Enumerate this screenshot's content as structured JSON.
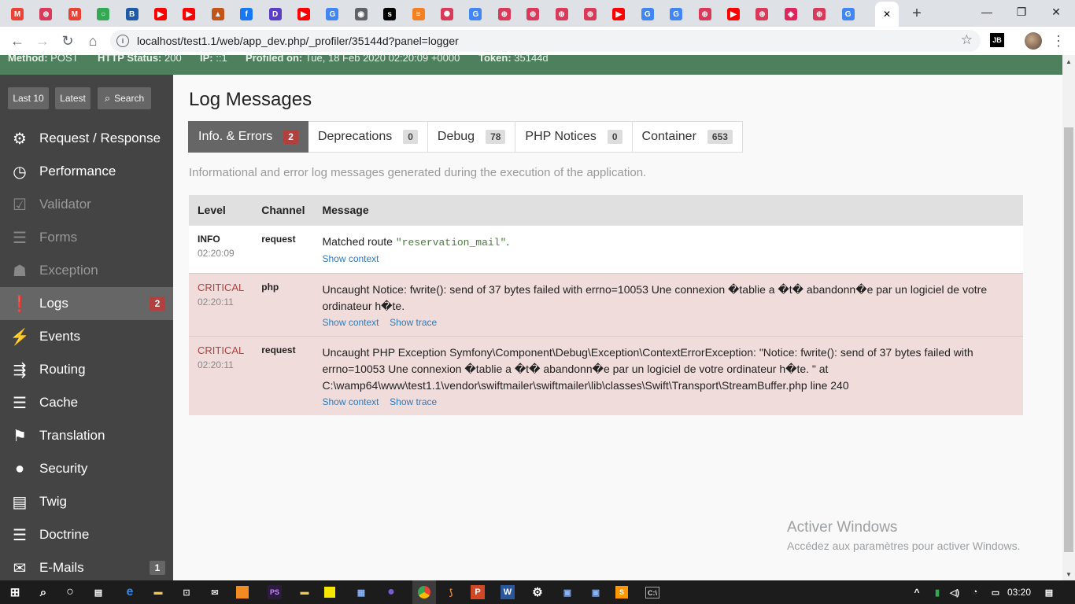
{
  "browser": {
    "url": "localhost/test1.1/web/app_dev.php/_profiler/35144d?panel=logger",
    "tabs": [
      {
        "icon": "gmail-icon",
        "color": "#ea4335",
        "glyph": "M"
      },
      {
        "icon": "web-icon",
        "color": "#d93a5a",
        "glyph": "⊕"
      },
      {
        "icon": "gmail-icon",
        "color": "#ea4335",
        "glyph": "M"
      },
      {
        "icon": "circle-icon",
        "color": "#34a853",
        "glyph": "○"
      },
      {
        "icon": "b-icon",
        "color": "#1f5aa6",
        "glyph": "B"
      },
      {
        "icon": "youtube-icon",
        "color": "#ff0000",
        "glyph": "▶"
      },
      {
        "icon": "youtube-icon",
        "color": "#ff0000",
        "glyph": "▶"
      },
      {
        "icon": "pka-icon",
        "color": "#c2561a",
        "glyph": "▲"
      },
      {
        "icon": "facebook-icon",
        "color": "#1877f2",
        "glyph": "f"
      },
      {
        "icon": "d-icon",
        "color": "#5b3ec8",
        "glyph": "D"
      },
      {
        "icon": "youtube-icon",
        "color": "#ff0000",
        "glyph": "▶"
      },
      {
        "icon": "google-icon",
        "color": "#4285f4",
        "glyph": "G"
      },
      {
        "icon": "globe-icon",
        "color": "#5f6368",
        "glyph": "◉"
      },
      {
        "icon": "symfony-icon",
        "color": "#000000",
        "glyph": "s"
      },
      {
        "icon": "stackoverflow-icon",
        "color": "#f48024",
        "glyph": "≡"
      },
      {
        "icon": "gear-red-icon",
        "color": "#d93a5a",
        "glyph": "✺"
      },
      {
        "icon": "google-icon",
        "color": "#4285f4",
        "glyph": "G"
      },
      {
        "icon": "web-icon",
        "color": "#d93a5a",
        "glyph": "⊕"
      },
      {
        "icon": "web-icon",
        "color": "#d93a5a",
        "glyph": "⊕"
      },
      {
        "icon": "web-icon",
        "color": "#d93a5a",
        "glyph": "⊕"
      },
      {
        "icon": "web-icon",
        "color": "#d93a5a",
        "glyph": "⊕"
      },
      {
        "icon": "youtube-icon",
        "color": "#ff0000",
        "glyph": "▶"
      },
      {
        "icon": "google-icon",
        "color": "#4285f4",
        "glyph": "G"
      },
      {
        "icon": "google-icon",
        "color": "#4285f4",
        "glyph": "G"
      },
      {
        "icon": "web-icon",
        "color": "#d93a5a",
        "glyph": "⊕"
      },
      {
        "icon": "youtube-icon",
        "color": "#ff0000",
        "glyph": "▶"
      },
      {
        "icon": "web-icon",
        "color": "#d93a5a",
        "glyph": "⊕"
      },
      {
        "icon": "puzzle-icon",
        "color": "#e0245e",
        "glyph": "◈"
      },
      {
        "icon": "web-icon",
        "color": "#d93a5a",
        "glyph": "⊕"
      },
      {
        "icon": "google-icon",
        "color": "#4285f4",
        "glyph": "G"
      }
    ]
  },
  "summary": {
    "method_label": "Method:",
    "method_value": "POST",
    "status_label": "HTTP Status:",
    "status_value": "200",
    "ip_label": "IP:",
    "ip_value": "::1",
    "profiled_label": "Profiled on:",
    "profiled_value": "Tue, 18 Feb 2020 02:20:09 +0000",
    "token_label": "Token:",
    "token_value": "35144d"
  },
  "sidebar": {
    "buttons": {
      "last10": "Last 10",
      "latest": "Latest",
      "search": "Search"
    },
    "items": [
      {
        "label": "Request / Response",
        "icon": "gears-icon",
        "disabled": false
      },
      {
        "label": "Performance",
        "icon": "stopwatch-icon",
        "disabled": false
      },
      {
        "label": "Validator",
        "icon": "checkbox-icon",
        "disabled": true
      },
      {
        "label": "Forms",
        "icon": "form-icon",
        "disabled": true
      },
      {
        "label": "Exception",
        "icon": "ghost-icon",
        "disabled": true
      },
      {
        "label": "Logs",
        "icon": "exclamation-icon",
        "disabled": false,
        "count": "2"
      },
      {
        "label": "Events",
        "icon": "events-icon",
        "disabled": false
      },
      {
        "label": "Routing",
        "icon": "signpost-icon",
        "disabled": false
      },
      {
        "label": "Cache",
        "icon": "layers-icon",
        "disabled": false
      },
      {
        "label": "Translation",
        "icon": "translate-icon",
        "disabled": false
      },
      {
        "label": "Security",
        "icon": "user-icon",
        "disabled": false
      },
      {
        "label": "Twig",
        "icon": "template-icon",
        "disabled": false
      },
      {
        "label": "Doctrine",
        "icon": "database-icon",
        "disabled": false
      },
      {
        "label": "E-Mails",
        "icon": "envelope-icon",
        "disabled": false,
        "count": "1"
      }
    ]
  },
  "main": {
    "title": "Log Messages",
    "tabs": [
      {
        "label": "Info. & Errors",
        "count": "2",
        "active": true
      },
      {
        "label": "Deprecations",
        "count": "0"
      },
      {
        "label": "Debug",
        "count": "78"
      },
      {
        "label": "PHP Notices",
        "count": "0"
      },
      {
        "label": "Container",
        "count": "653"
      }
    ],
    "description": "Informational and error log messages generated during the execution of the application.",
    "columns": {
      "level": "Level",
      "channel": "Channel",
      "message": "Message"
    },
    "rows": [
      {
        "level": "INFO",
        "time": "02:20:09",
        "channel": "request",
        "message_prefix": "Matched route ",
        "message_code": "\"reservation_mail\"",
        "message_suffix": ".",
        "show_context": "Show context"
      },
      {
        "level": "CRITICAL",
        "time": "02:20:11",
        "channel": "php",
        "message": "Uncaught Notice: fwrite(): send of 37 bytes failed with errno=10053 Une connexion �tablie a �t� abandonn�e par un logiciel de votre ordinateur h�te.",
        "show_context": "Show context",
        "show_trace": "Show trace"
      },
      {
        "level": "CRITICAL",
        "time": "02:20:11",
        "channel": "request",
        "message": "Uncaught PHP Exception Symfony\\Component\\Debug\\Exception\\ContextErrorException: \"Notice: fwrite(): send of 37 bytes failed with errno=10053 Une connexion �tablie a �t� abandonn�e par un logiciel de votre ordinateur h�te. \" at C:\\wamp64\\www\\test1.1\\vendor\\swiftmailer\\swiftmailer\\lib\\classes\\Swift\\Transport\\StreamBuffer.php line 240",
        "show_context": "Show context",
        "show_trace": "Show trace"
      }
    ]
  },
  "watermark": {
    "line1": "Activer Windows",
    "line2": "Accédez aux paramètres pour activer Windows."
  },
  "taskbar": {
    "clock": "03:20"
  }
}
